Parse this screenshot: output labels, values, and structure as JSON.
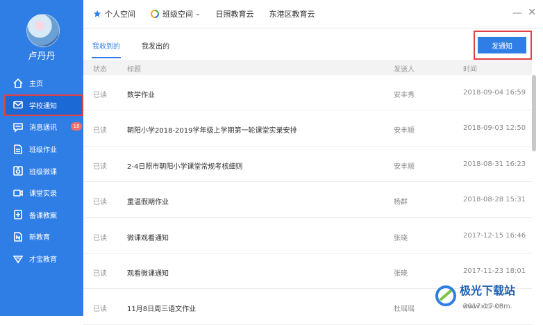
{
  "sidebar": {
    "username": "卢丹丹",
    "items": [
      {
        "label": "主页",
        "icon": "home-icon"
      },
      {
        "label": "学校通知",
        "icon": "mail-icon"
      },
      {
        "label": "消息通讯",
        "icon": "chat-icon",
        "badge": "18"
      },
      {
        "label": "班级作业",
        "icon": "document-icon"
      },
      {
        "label": "班级微课",
        "icon": "micro-lesson-icon"
      },
      {
        "label": "课堂实录",
        "icon": "video-icon"
      },
      {
        "label": "备课教案",
        "icon": "lesson-plan-icon"
      },
      {
        "label": "新教育",
        "icon": "new-education-icon"
      },
      {
        "label": "才宝教育",
        "icon": "shield-icon"
      }
    ]
  },
  "topbar": {
    "personal": "个人空间",
    "class_space": "班级空间",
    "rizhao": "日照教育云",
    "donggang": "东港区教育云",
    "minimize": "—",
    "close": "✕"
  },
  "tabs": {
    "received": "我收到的",
    "sent": "我发出的"
  },
  "notify_button": "发通知",
  "table": {
    "headers": [
      "状态",
      "标题",
      "发送人",
      "时间"
    ],
    "rows": [
      {
        "status": "已读",
        "title": "数学作业",
        "sender": "安丰秀",
        "time": "2018-09-04 16:59"
      },
      {
        "status": "已读",
        "title": "朝阳小学2018-2019学年级上学期第一轮课堂实录安排",
        "sender": "安丰顺",
        "time": "2018-09-03 12:50"
      },
      {
        "status": "已读",
        "title": "2-4日照市朝阳小学课堂常规考核细则",
        "sender": "安丰顺",
        "time": "2018-08-31 16:23"
      },
      {
        "status": "已读",
        "title": "重温假期作业",
        "sender": "杨群",
        "time": "2018-08-28 15:31"
      },
      {
        "status": "已读",
        "title": "微课观看通知",
        "sender": "张晓",
        "time": "2017-12-15 16:46"
      },
      {
        "status": "已读",
        "title": "观看微课通知",
        "sender": "张晓",
        "time": "2017-11-23 18:01"
      },
      {
        "status": "已读",
        "title": "11月8日周三语文作业",
        "sender": "杜瑶瑶",
        "time": "2017-11-08 ..."
      }
    ]
  },
  "watermark": {
    "text": "极光下载站",
    "url": "www.xz7.com"
  },
  "colors": {
    "accent": "#2f7ee6",
    "highlight": "#e04141"
  }
}
